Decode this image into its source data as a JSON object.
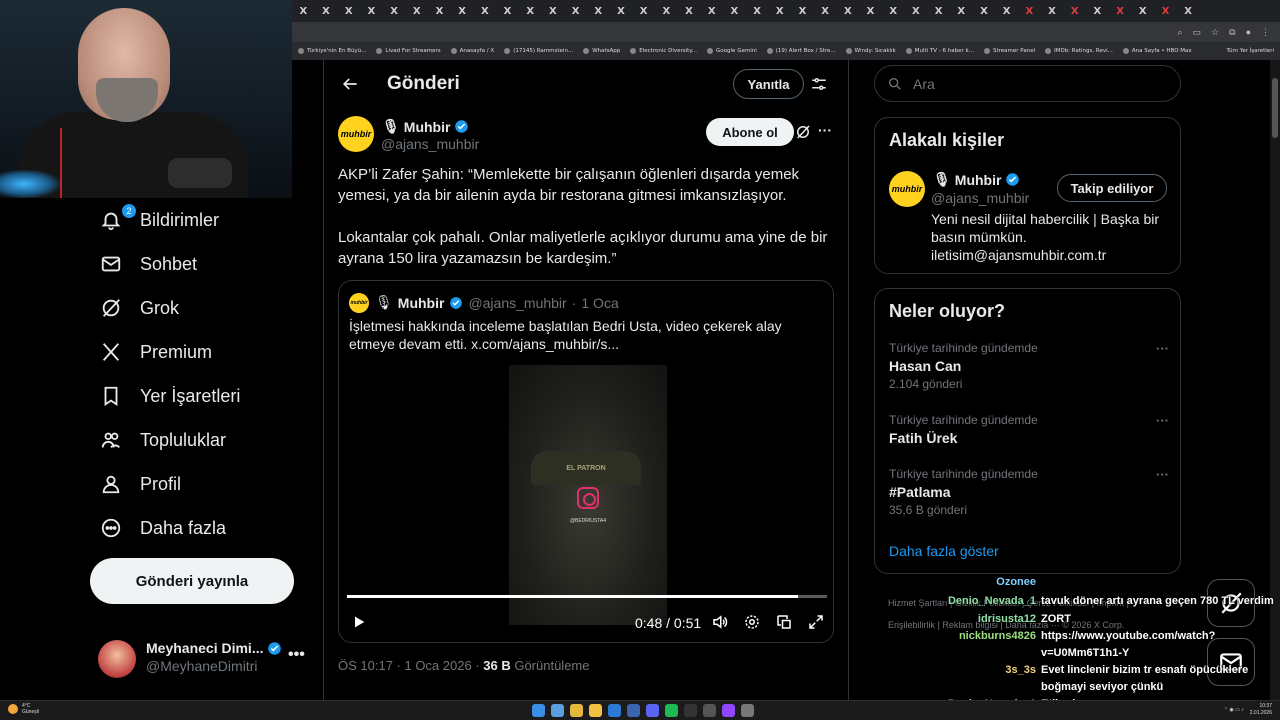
{
  "browser": {
    "tabs": [
      "X",
      "X",
      "X",
      "X",
      "X",
      "X",
      "X",
      "X",
      "X",
      "X",
      "X",
      "X",
      "X",
      "X",
      "X",
      "X",
      "X",
      "X",
      "X",
      "X",
      "X",
      "X",
      "X",
      "X",
      "X",
      "X",
      "X",
      "X",
      "X",
      "X",
      "X",
      "X",
      "X",
      "X",
      "X",
      "X",
      "X",
      "X",
      "X",
      "X"
    ],
    "bookmarks": [
      "Türkiye'nin En Büyü...",
      "Livad For Streamers",
      "Anasayfa / X",
      "(17145) Rammstein...",
      "WhatsApp",
      "Electronic Diversity...",
      "Google Gemini",
      "(19) Alert Box / Stre...",
      "Windy: Sıcaklık",
      "Multi TV - 6 haber k...",
      "Streamer Panel",
      "IMDb: Ratings, Revi...",
      "Ana Sayfa • HBO Max"
    ],
    "bookmarks_right": "Tüm Yer İşaretleri"
  },
  "nav": {
    "items": [
      {
        "label": "Bildirimler",
        "icon": "bell-icon"
      },
      {
        "label": "Sohbet",
        "icon": "mail-icon"
      },
      {
        "label": "Grok",
        "icon": "grok-icon"
      },
      {
        "label": "Premium",
        "icon": "x-logo-icon"
      },
      {
        "label": "Yer İşaretleri",
        "icon": "bookmark-icon"
      },
      {
        "label": "Topluluklar",
        "icon": "people-icon"
      },
      {
        "label": "Profil",
        "icon": "person-icon"
      },
      {
        "label": "Daha fazla",
        "icon": "more-circle-icon"
      }
    ],
    "notif_count": "2",
    "post_button": "Gönderi yayınla",
    "account": {
      "name": "Meyhaneci Dimi...",
      "handle": "@MeyhaneDimitri",
      "more": "•••"
    }
  },
  "post": {
    "page_title": "Gönderi",
    "reply_button": "Yanıtla",
    "author": {
      "name": "Muhbir",
      "handle": "@ajans_muhbir",
      "avatar_text": "muhbir"
    },
    "subscribe_button": "Abone ol",
    "text_1": "AKP’li Zafer Şahin: “Memlekette bir çalışanın öğlenleri dışarda yemek yemesi, ya da bir ailenin ayda bir restorana gitmesi imkansızlaşıyor.",
    "text_2": "Lokantalar çok pahalı. Onlar maliyetlerle açıklıyor durumu ama yine de bir ayrana 150 lira yazamazsın be kardeşim.”",
    "quote": {
      "name": "Muhbir",
      "handle": "@ajans_muhbir",
      "date": "1 Oca",
      "separator": "·",
      "text": "İşletmesi hakkında inceleme başlatılan Bedri Usta, video çekerek alay etmeye devam etti.  x.com/ajans_muhbir/s...",
      "video": {
        "hat_text": "EL PATRON",
        "tag": "@BEDRIUSTA4",
        "current": "0:48",
        "total": "0:51",
        "time_sep": "/",
        "progress": 0.94
      }
    },
    "meta_time": "ÖS 10:17 · 1 Oca 2026 · ",
    "views_count": "36 B",
    "views_label": " Görüntüleme"
  },
  "sidebar": {
    "search_placeholder": "Ara",
    "related_title": "Alakalı kişiler",
    "related": {
      "name": "Muhbir",
      "handle": "@ajans_muhbir",
      "button": "Takip ediliyor",
      "bio": "Yeni nesil dijital habercilik | Başka bir basın mümkün. iletisim@ajansmuhbir.com.tr"
    },
    "trends_title": "Neler oluyor?",
    "trends": [
      {
        "context": "Türkiye tarihinde gündemde",
        "title": "Hasan Can",
        "count": "2.104 gönderi"
      },
      {
        "context": "Türkiye tarihinde gündemde",
        "title": "Fatih Ürek",
        "count": ""
      },
      {
        "context": "Türkiye tarihinde gündemde",
        "title": "#Patlama",
        "count": "35,6 B gönderi"
      }
    ],
    "show_more": "Daha fazla göster",
    "footer": "Hizmet Şartları  |  Gizlilik Politikası  |  Çerez Politikası  |  Imprint  |  Erişilebilirlik  |  Reklam bilgisi  |  Daha fazla ···  © 2026 X Corp."
  },
  "chat": [
    {
      "user": "Ozonee",
      "msg": "",
      "color": "#7fd1ff"
    },
    {
      "user": "Denio_Nevada_1",
      "msg": "tavuk döner artı ayrana geçen 780 TL verdim",
      "color": "#8fe0a8"
    },
    {
      "user": "idrisusta12",
      "msg": "ZORT",
      "color": "#8fe0a8"
    },
    {
      "user": "nickburns4826",
      "msg": "https://www.youtube.com/watch?",
      "color": "#9be07f"
    },
    {
      "user": "",
      "msg": "v=U0Mm6T1h1-Y",
      "color": "#ffffff"
    },
    {
      "user": "3s_3s",
      "msg": "Evet linclenir bizim tr esnafı öpücüklere",
      "color": "#f0d27f"
    },
    {
      "user": "",
      "msg": "boğmayi seviyor çünkü",
      "color": "#ffffff"
    },
    {
      "user": "Denio_Nevada_1",
      "msg": "Etilerde",
      "color": "#8fe0a8"
    }
  ],
  "taskbar": {
    "weather_temp": "4°C",
    "weather_desc": "Güneşli",
    "time": "10:37",
    "date": "2.01.2026"
  },
  "colors": {
    "accent": "#1d9bf0",
    "avatar_yellow": "#ffd21f",
    "border": "#2f3336",
    "muted": "#71767b"
  }
}
